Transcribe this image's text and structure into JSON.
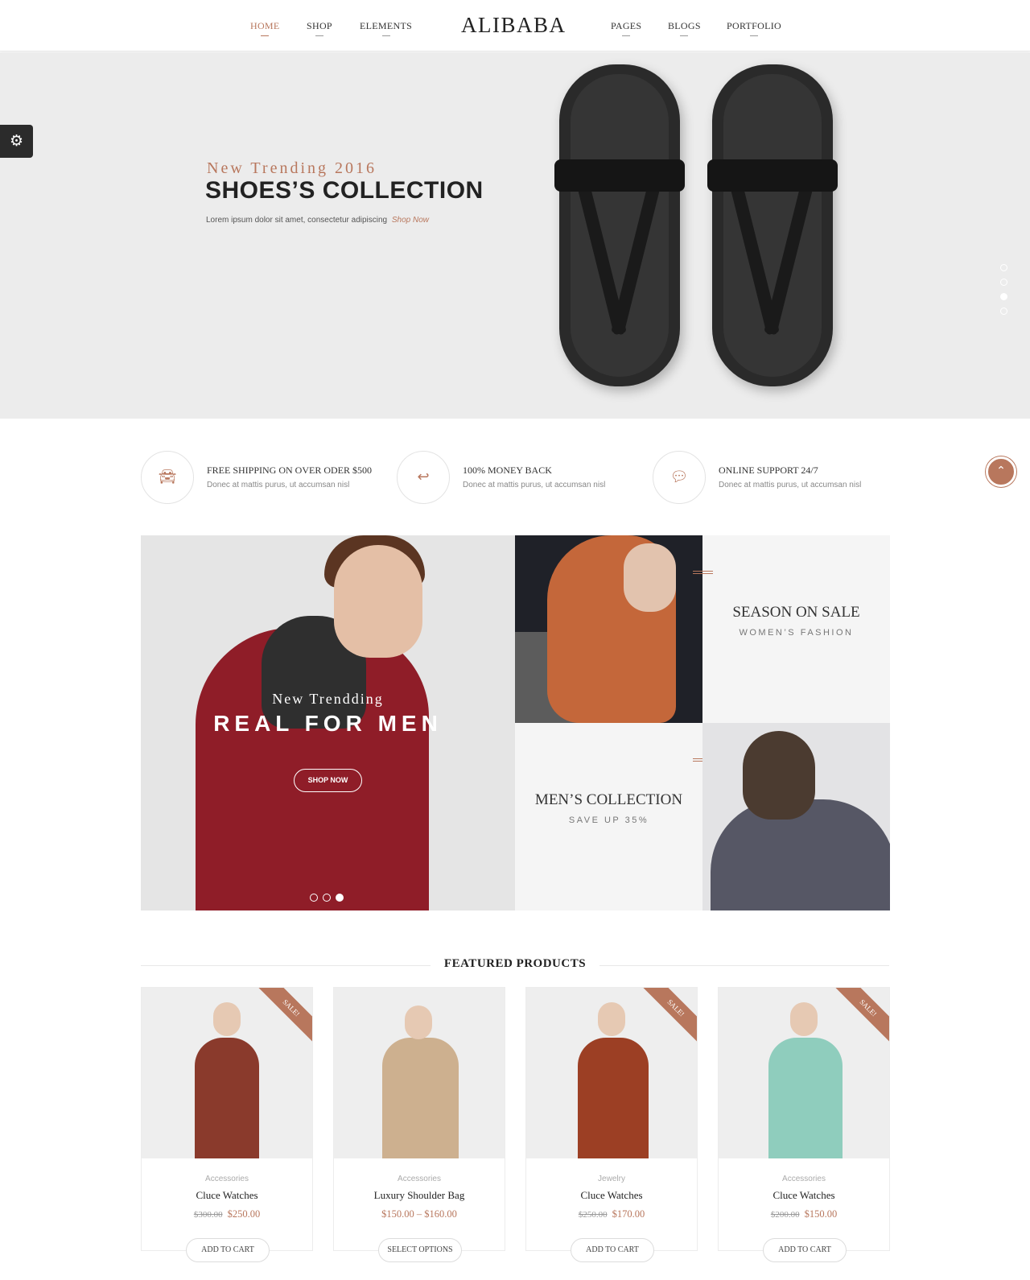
{
  "header": {
    "logo": "ALIBABA",
    "nav_left": [
      "HOME",
      "SHOP",
      "ELEMENTS"
    ],
    "nav_right": [
      "PAGES",
      "BLOGS",
      "PORTFOLIO"
    ],
    "active": "HOME"
  },
  "hero": {
    "subtitle": "New Trending 2016",
    "title": "SHOES’S COLLECTION",
    "description": "Lorem ipsum dolor sit amet, consectetur adipiscing",
    "link": "Shop Now",
    "slide_count": 4,
    "active_slide": 3
  },
  "features": [
    {
      "icon": "car-icon",
      "title": "FREE SHIPPING ON OVER ODER $500",
      "desc": "Donec at mattis purus, ut accumsan nisl"
    },
    {
      "icon": "reply-icon",
      "title": "100% MONEY BACK",
      "desc": "Donec at mattis purus, ut accumsan nisl"
    },
    {
      "icon": "chat-icon",
      "title": "ONLINE SUPPORT 24/7",
      "desc": "Donec at mattis purus, ut accumsan nisl"
    }
  ],
  "banner_main": {
    "subtitle": "New Trendding",
    "title": "REAL FOR MEN",
    "button": "SHOP NOW",
    "slide_count": 3,
    "active_slide": 3
  },
  "tile_women": {
    "title": "SEASON ON SALE",
    "subtitle": "WOMEN’S FASHION"
  },
  "tile_men": {
    "title": "MEN’S COLLECTION",
    "subtitle": "SAVE UP 35%"
  },
  "featured": {
    "title": "FEATURED PRODUCTS",
    "products": [
      {
        "category": "Accessories",
        "name": "Cluce Watches",
        "old_price": "$300.00",
        "price": "$250.00",
        "sale": "SALE!",
        "button": "ADD TO CART"
      },
      {
        "category": "Accessories",
        "name": "Luxury Shoulder Bag",
        "old_price": "",
        "price": "$150.00 – $160.00",
        "sale": "",
        "button": "SELECT OPTIONS"
      },
      {
        "category": "Jewelry",
        "name": "Cluce Watches",
        "old_price": "$250.00",
        "price": "$170.00",
        "sale": "SALE!",
        "button": "ADD TO CART"
      },
      {
        "category": "Accessories",
        "name": "Cluce Watches",
        "old_price": "$200.00",
        "price": "$150.00",
        "sale": "SALE!",
        "button": "ADD TO CART"
      }
    ]
  },
  "colors": {
    "accent": "#b8775d",
    "dark": "#222222",
    "hero_bg": "#ececec"
  }
}
